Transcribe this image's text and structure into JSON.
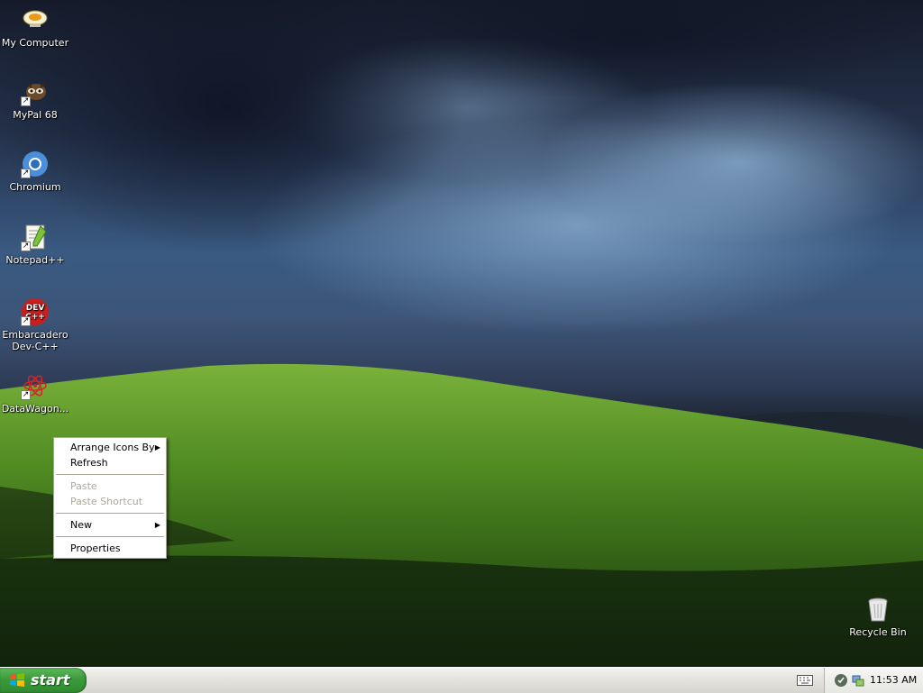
{
  "desktop": {
    "icons": [
      {
        "label": "My Computer",
        "icon": "my-computer-icon",
        "shortcut": false
      },
      {
        "label": "MyPal 68",
        "icon": "mypal-icon",
        "shortcut": true
      },
      {
        "label": "Chromium",
        "icon": "chromium-icon",
        "shortcut": true
      },
      {
        "label": "Notepad++",
        "icon": "notepad-plus-plus-icon",
        "shortcut": true
      },
      {
        "label": "Embarcadero Dev-C++",
        "icon": "dev-cpp-icon",
        "shortcut": true
      },
      {
        "label": "DataWagon...",
        "icon": "datawagon-icon",
        "shortcut": true
      }
    ],
    "recycle_bin": {
      "label": "Recycle Bin",
      "icon": "recycle-bin-icon"
    }
  },
  "context_menu": {
    "items": [
      {
        "label": "Arrange Icons By",
        "submenu": true,
        "enabled": true
      },
      {
        "label": "Refresh",
        "submenu": false,
        "enabled": true
      },
      {
        "label": "Paste",
        "submenu": false,
        "enabled": false
      },
      {
        "label": "Paste Shortcut",
        "submenu": false,
        "enabled": false
      },
      {
        "label": "New",
        "submenu": true,
        "enabled": true
      },
      {
        "label": "Properties",
        "submenu": false,
        "enabled": true
      }
    ]
  },
  "taskbar": {
    "start_label": "start",
    "clock": "11:53 AM"
  },
  "colors": {
    "start_green": "#3c9a3c",
    "menu_disabled": "#aca899",
    "taskbar": "#e4e3dd"
  }
}
